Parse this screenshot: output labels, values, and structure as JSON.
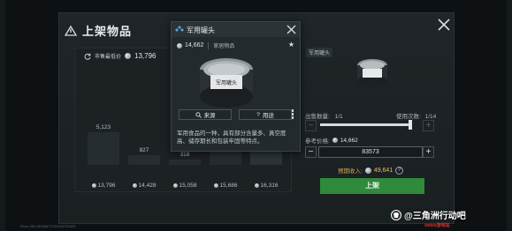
{
  "header": {
    "title": "上架物品"
  },
  "chart": {
    "lowest_label": "市售最低价",
    "lowest_value": "13,796",
    "bars": [
      {
        "count": "5,123",
        "price": "13,796",
        "level": 0.39
      },
      {
        "count": "827",
        "price": "14,428",
        "level": 0.11
      },
      {
        "count": "318",
        "price": "15,058",
        "level": 0.06
      },
      {
        "count": "5,512",
        "price": "15,686",
        "level": 0.42
      },
      {
        "count": "",
        "price": "16,316",
        "level": 1.0
      }
    ]
  },
  "right": {
    "item_tag": "军用罐头",
    "sell_qty_label": "出售数量:",
    "sell_qty_value": "1/1",
    "use_count_label": "使用次数:",
    "use_count_value": "1/14",
    "ref_price_label": "参考价格:",
    "ref_price_value": "14,662",
    "quantity_value": "83573",
    "income_label": "预期收入:",
    "income_value": "49,641",
    "list_button": "上架",
    "slider_value": 1.0
  },
  "popup": {
    "title": "军用罐头",
    "price": "14,662",
    "category": "家居物品",
    "weight": "0.31KG",
    "source_button": "来源",
    "usage_button": "用途",
    "description": "军用食品的一种，具有部分含量多、真空度高、储存期长和包装牢固等特点。"
  },
  "can_label": "军用罐头",
  "status_text": "19ms   UID:18098873742484782839",
  "watermark": {
    "text": "@三角洲行动吧",
    "sub": "swiss游戏站"
  },
  "colors": {
    "list_button": "#2f8a3c",
    "income": "#e2c15a"
  }
}
